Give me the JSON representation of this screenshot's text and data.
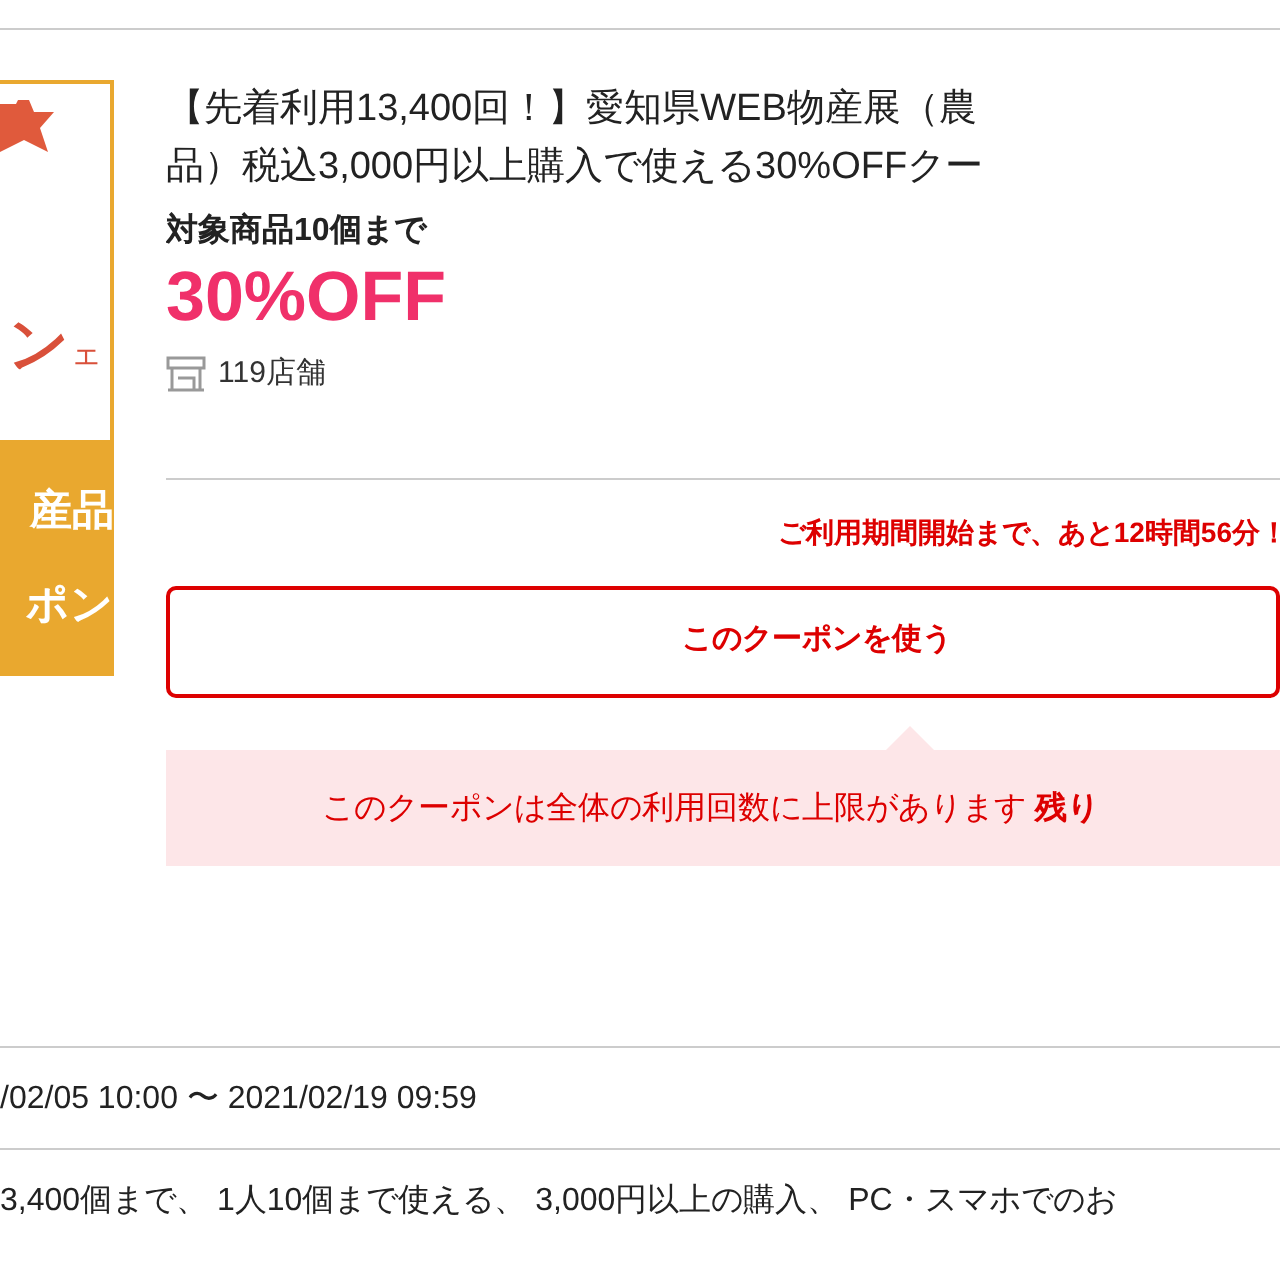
{
  "thumbnail": {
    "big_text": "ン",
    "small_text": "ェ",
    "band_lines": [
      "産品",
      "ポン"
    ]
  },
  "coupon": {
    "title_lines": [
      "【先着利用13,400回！】愛知県WEB物産展（農",
      "品）税込3,000円以上購入で使える30%OFFクー"
    ],
    "limit": "対象商品10個まで",
    "discount": "30%OFF",
    "stores": "119店舗"
  },
  "countdown": "ご利用期間開始まで、あと12時間56分！",
  "use_button": "このクーポンを使う",
  "notice": "このクーポンは全体の利用回数に上限があります **残り**",
  "period": "/02/05 10:00 〜 2021/02/19 09:59",
  "conditions": "3,400個まで、 1人10個まで使える、 3,000円以上の購入、 PC・スマホでのお"
}
